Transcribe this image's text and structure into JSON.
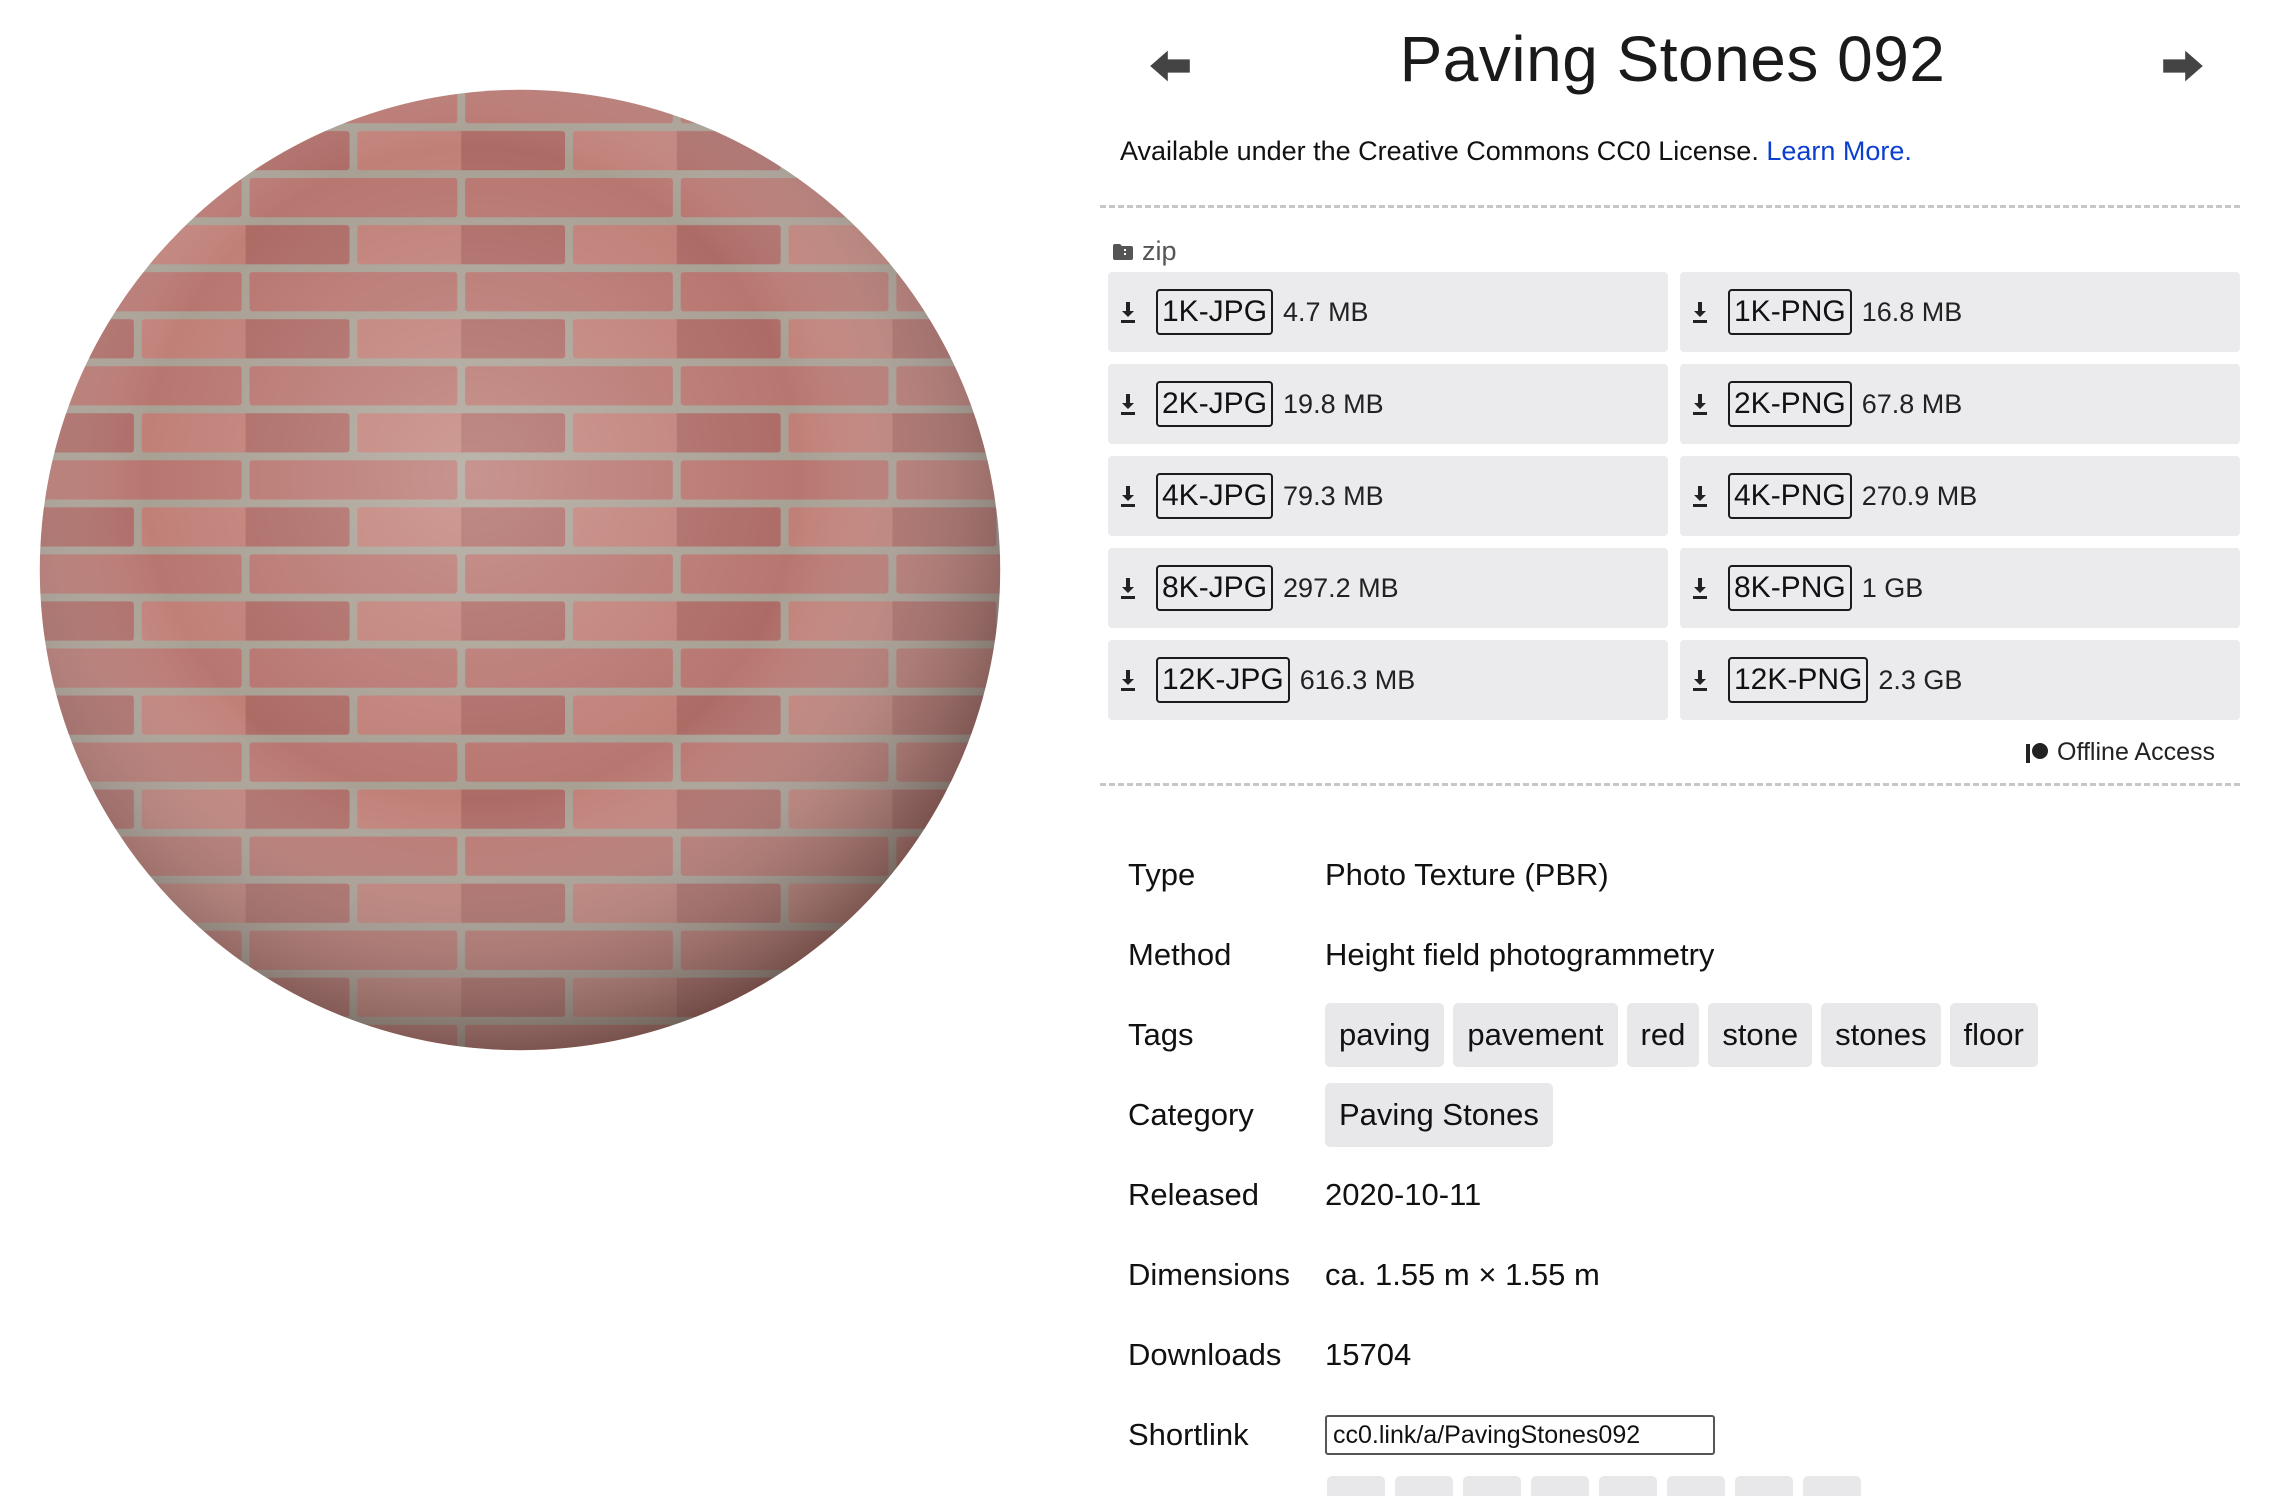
{
  "header": {
    "title": "Paving Stones 092",
    "prev_icon": "arrow-left-icon",
    "next_icon": "arrow-right-icon"
  },
  "license": {
    "text": "Available under the Creative Commons CC0 License.",
    "link_label": "Learn More."
  },
  "downloads": {
    "group_label": "zip",
    "group_icon": "folder-zip-icon",
    "items": [
      {
        "label": "1K-JPG",
        "size": "4.7 MB"
      },
      {
        "label": "1K-PNG",
        "size": "16.8 MB"
      },
      {
        "label": "2K-JPG",
        "size": "19.8 MB"
      },
      {
        "label": "2K-PNG",
        "size": "67.8 MB"
      },
      {
        "label": "4K-JPG",
        "size": "79.3 MB"
      },
      {
        "label": "4K-PNG",
        "size": "270.9 MB"
      },
      {
        "label": "8K-JPG",
        "size": "297.2 MB"
      },
      {
        "label": "8K-PNG",
        "size": "1 GB"
      },
      {
        "label": "12K-JPG",
        "size": "616.3 MB"
      },
      {
        "label": "12K-PNG",
        "size": "2.3 GB"
      }
    ],
    "offline_label": "Offline Access",
    "offline_icon": "patreon-icon"
  },
  "info": {
    "type_label": "Type",
    "type_value": "Photo Texture (PBR)",
    "method_label": "Method",
    "method_value": "Height field photogrammetry",
    "tags_label": "Tags",
    "tags": [
      "paving",
      "pavement",
      "red",
      "stone",
      "stones",
      "floor"
    ],
    "category_label": "Category",
    "category_value": "Paving Stones",
    "released_label": "Released",
    "released_value": "2020-10-11",
    "dimensions_label": "Dimensions",
    "dimensions_value": "ca. 1.55 m × 1.55 m",
    "downloads_label": "Downloads",
    "downloads_value": "15704",
    "shortlink_label": "Shortlink",
    "shortlink_value": "cc0.link/a/PavingStones092"
  },
  "colors": {
    "link": "#0b3fd0",
    "button_bg": "#ebebee",
    "brick": "#b5706a",
    "mortar": "#b9ada0"
  }
}
